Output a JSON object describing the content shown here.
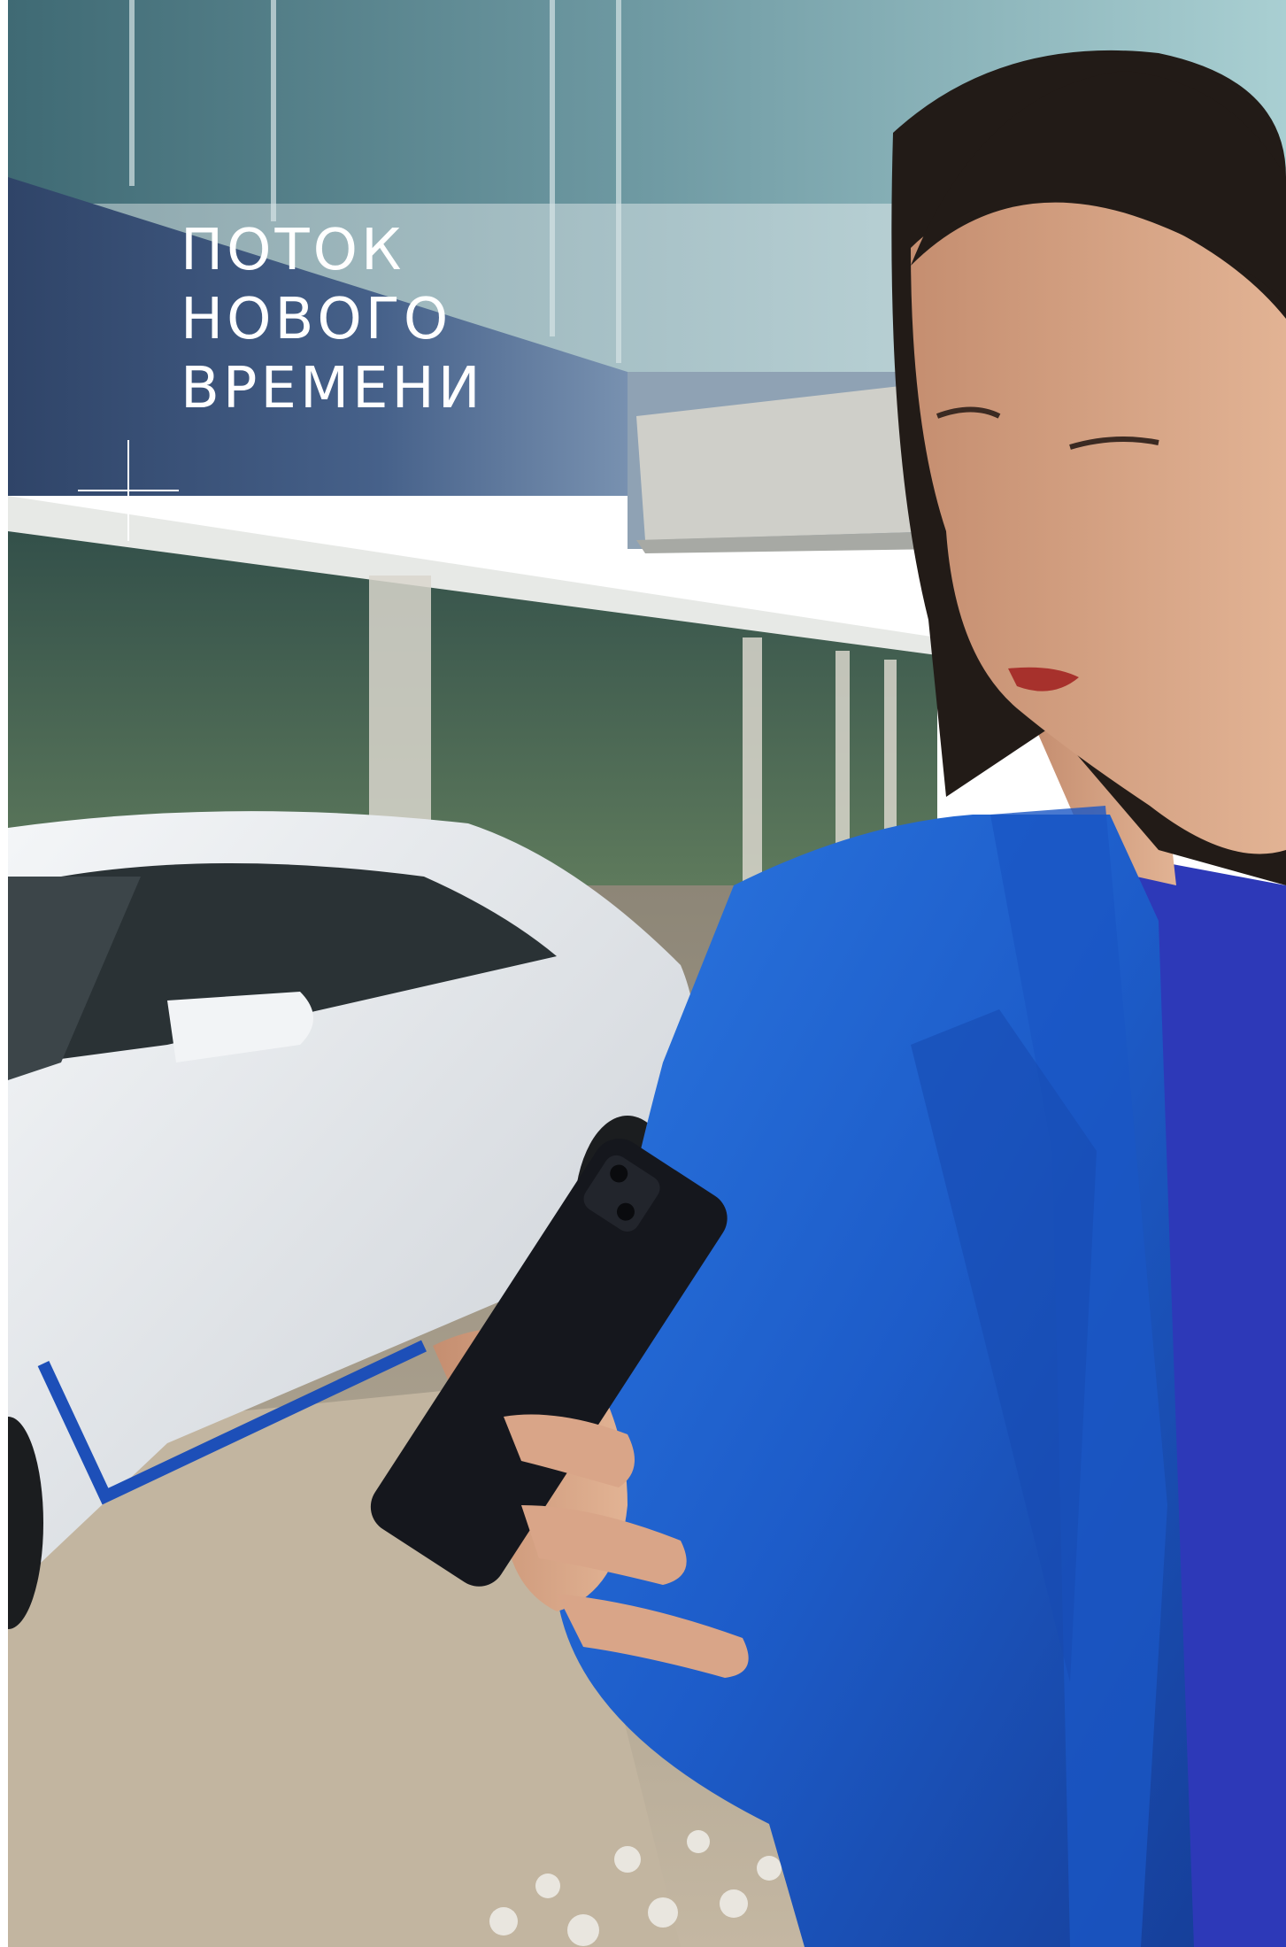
{
  "headline": {
    "lines": [
      "ПОТОК",
      "НОВОГО",
      "ВРЕМЕНИ"
    ]
  },
  "colors": {
    "text": "#ffffff",
    "coat": "#1f5fd0",
    "sweater": "#2d39b8",
    "car_body": "#e9ecef",
    "car_stripe": "#1d4fb8",
    "building_panel": "#3a4f73",
    "glass": "#5f8a96",
    "pavement": "#b8ac98"
  },
  "icons": {
    "decoration": "crosshair-icon"
  }
}
